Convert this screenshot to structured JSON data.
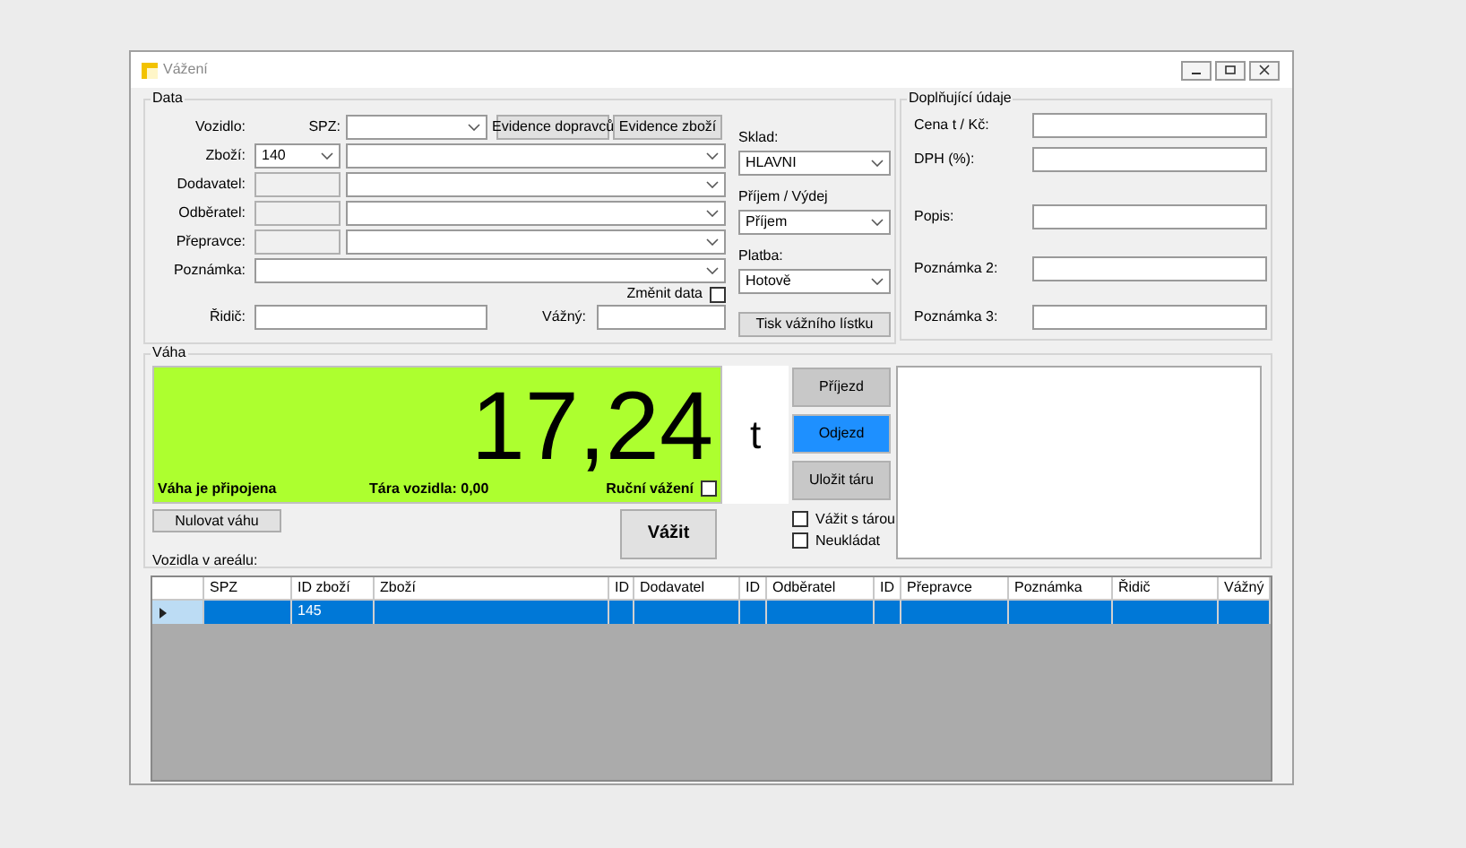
{
  "window": {
    "title": "Vážení"
  },
  "data": {
    "title": "Data",
    "vehicle_label": "Vozidlo:",
    "spz_label": "SPZ:",
    "buttons": [
      "Evidence dopravců",
      "Evidence zboží"
    ],
    "rows": [
      {
        "label": "Zboží:",
        "code": {
          "kind": "combo",
          "value": "140"
        }
      },
      {
        "label": "Dodavatel:",
        "code": {
          "kind": "readonly"
        }
      },
      {
        "label": "Odběratel:",
        "code": {
          "kind": "readonly"
        }
      },
      {
        "label": "Přepravce:",
        "code": {
          "kind": "readonly"
        }
      }
    ],
    "note_label": "Poznámka:",
    "change_data": {
      "label": "Změnit data",
      "checked": false
    },
    "driver_label": "Řidič:",
    "weigher_label": "Vážný:",
    "side": [
      {
        "label": "Sklad:",
        "value": "HLAVNI"
      },
      {
        "label": "Příjem / Výdej",
        "value": "Příjem"
      },
      {
        "label": "Platba:",
        "value": "Hotově"
      }
    ],
    "print_button": "Tisk vážního lístku"
  },
  "extra": {
    "title": "Doplňující údaje",
    "fields": [
      {
        "label": "Cena t / Kč:"
      },
      {
        "label": "DPH (%):"
      },
      {
        "label": "Popis:"
      },
      {
        "label": "Poznámka 2:"
      },
      {
        "label": "Poznámka 3:"
      }
    ]
  },
  "scale": {
    "title": "Váha",
    "reading": "17,24",
    "unit": "t",
    "status": "Váha je připojena",
    "tare": "Tára vozidla: 0,00",
    "manual": {
      "label": "Ruční vážení",
      "checked": false
    },
    "actions": [
      {
        "label": "Příjezd",
        "selected": false
      },
      {
        "label": "Odjezd",
        "selected": true
      },
      {
        "label": "Uložit táru",
        "selected": false
      }
    ],
    "options": [
      {
        "label": "Vážit s tárou",
        "checked": false
      },
      {
        "label": "Neukládat",
        "checked": false
      }
    ],
    "zero_button": "Nulovat váhu",
    "weigh_button": "Vážit"
  },
  "vehicles": {
    "title": "Vozidla v areálu:",
    "columns": [
      "SPZ",
      "ID zboží",
      "Zboží",
      "ID",
      "Dodavatel",
      "ID",
      "Odběratel",
      "ID",
      "Přepravce",
      "Poznámka",
      "Řidič",
      "Vážný"
    ],
    "rows": [
      {
        "selected": true,
        "id_zbozi": "145"
      }
    ]
  }
}
